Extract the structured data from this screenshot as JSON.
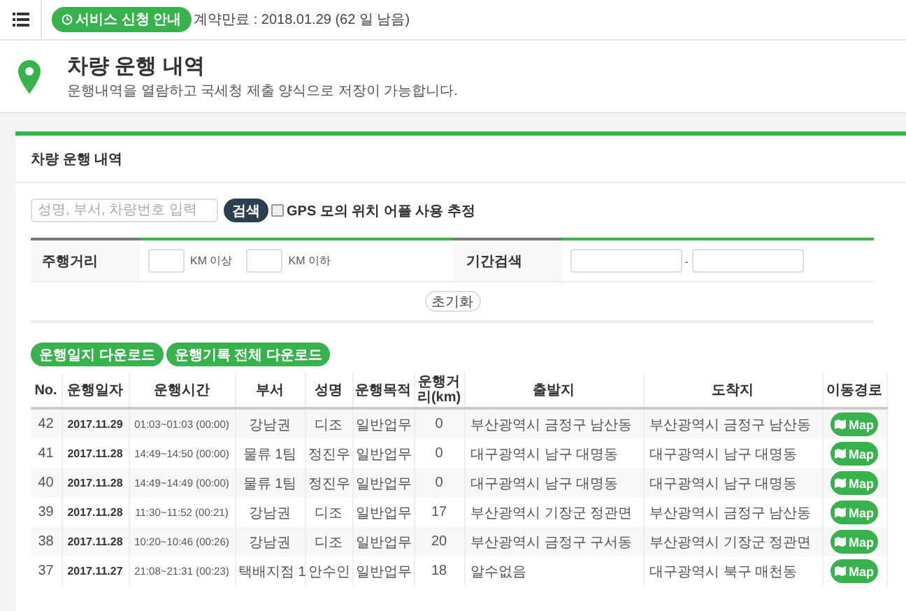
{
  "topbar": {
    "service_button": "서비스 신청 안내",
    "contract": "계약만료 : 2018.01.29 (62 일 남음)"
  },
  "header": {
    "title": "차량 운행 내역",
    "subtitle": "운행내역을 열람하고 국세청 제출 양식으로 저장이 가능합니다."
  },
  "panel": {
    "title": "차량 운행 내역",
    "search": {
      "placeholder": "성명, 부서, 차량번호 입력",
      "button": "검색"
    },
    "gps": {
      "label": "GPS 모의 위치 어플 사용 추정",
      "checked": false
    },
    "filters": {
      "distance_label": "주행거리",
      "min_unit": "KM 이상",
      "max_unit": "KM 이하",
      "period_label": "기간검색",
      "separator": "-"
    },
    "reset": "초기화",
    "downloads": [
      "운행일지 다운로드",
      "운행기록 전체 다운로드"
    ],
    "table": {
      "columns": [
        "No.",
        "운행일자",
        "운행시간",
        "부서",
        "성명",
        "운행목적",
        "운행거리(km)",
        "출발지",
        "도착지",
        "이동경로"
      ],
      "rows": [
        {
          "cells": [
            "42",
            "2017.11.29",
            "01:03~01:03 (00:00)",
            "강남권",
            "디조",
            "일반업무",
            "0",
            "부산광역시 금정구 남산동",
            "부산광역시 금정구 남산동"
          ],
          "button": "Map"
        },
        {
          "cells": [
            "41",
            "2017.11.28",
            "14:49~14:50 (00:00)",
            "물류 1팀",
            "정진우",
            "일반업무",
            "0",
            "대구광역시 남구 대명동",
            "대구광역시 남구 대명동"
          ],
          "button": "Map"
        },
        {
          "cells": [
            "40",
            "2017.11.28",
            "14:49~14:49 (00:00)",
            "물류 1팀",
            "정진우",
            "일반업무",
            "0",
            "대구광역시 남구 대명동",
            "대구광역시 남구 대명동"
          ],
          "button": "Map"
        },
        {
          "cells": [
            "39",
            "2017.11.28",
            "11:30~11:52 (00:21)",
            "강남권",
            "디조",
            "일반업무",
            "17",
            "부산광역시 기장군 정관면",
            "부산광역시 금정구 남산동"
          ],
          "button": "Map"
        },
        {
          "cells": [
            "38",
            "2017.11.28",
            "10:20~10:46 (00:26)",
            "강남권",
            "디조",
            "일반업무",
            "20",
            "부산광역시 금정구 구서동",
            "부산광역시 기장군 정관면"
          ],
          "button": "Map"
        },
        {
          "cells": [
            "37",
            "2017.11.27",
            "21:08~21:31 (00:23)",
            "택배지점 1",
            "안수인",
            "일반업무",
            "18",
            "알수없음",
            "대구광역시 북구 매천동"
          ],
          "button": "Map"
        }
      ]
    }
  }
}
